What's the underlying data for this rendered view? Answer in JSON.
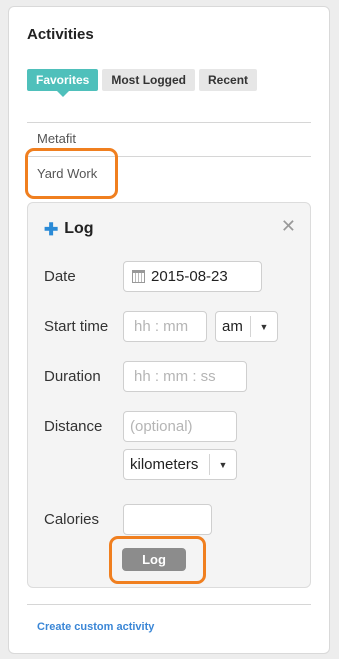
{
  "header": {
    "title": "Activities"
  },
  "tabs": [
    {
      "label": "Favorites",
      "active": true
    },
    {
      "label": "Most Logged",
      "active": false
    },
    {
      "label": "Recent",
      "active": false
    }
  ],
  "activities": [
    "Metafit",
    "Yard Work"
  ],
  "log_form": {
    "title": "Log",
    "date_label": "Date",
    "date_value": "2015-08-23",
    "start_time_label": "Start time",
    "start_time_placeholder": "hh  : mm",
    "ampm_value": "am",
    "duration_label": "Duration",
    "duration_placeholder": "hh  : mm :  ss",
    "distance_label": "Distance",
    "distance_placeholder": "(optional)",
    "distance_unit": "kilometers",
    "calories_label": "Calories",
    "calories_value": "",
    "log_button": "Log"
  },
  "footer": {
    "create_link": "Create custom activity"
  },
  "colors": {
    "accent": "#4fc0bb",
    "highlight": "#f07f1f",
    "link": "#3a86d6",
    "plus_icon": "#2a8ad6"
  }
}
